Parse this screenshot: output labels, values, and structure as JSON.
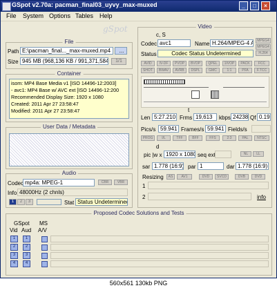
{
  "window": {
    "title": "GSpot v2.70a: pacman_final03_uyvy_max-muxed",
    "minimize": "_",
    "maximize": "□",
    "close": "×"
  },
  "menu": [
    "File",
    "System",
    "Options",
    "Tables",
    "Help"
  ],
  "file": {
    "title": "File",
    "path_label": "Path",
    "path_value": "E:\\pacman_final..._max-muxed.mp4",
    "browse": "...",
    "size_label": "Size",
    "size_value": "945 MB (968,136 KB / 991,371,584",
    "page": "1/1"
  },
  "container": {
    "title": "Container",
    "lines": [
      "isom: MP4  Base Media v1 [ISO 14496-12:2003]",
      "- avc1: MP4 Base w/ AVC ext [ISO 14496-12:200",
      "Recommended Display Size: 1920 x 1080",
      "Created:   2011 Apr 27   23:58:47",
      "Modified:  2011 Apr 27   23:58:47"
    ]
  },
  "userdata": {
    "title": "User Data / Metadata"
  },
  "audio": {
    "title": "Audio",
    "codec_label": "Codec",
    "codec_value": "mp4a: MPEG-1",
    "btn_cbr": "CBR",
    "btn_vbr": "VBR",
    "info_label": "Info",
    "info_value": "48000Hz  (2 chnls)",
    "stat_label": "Stat",
    "stat_value": "Status Undetermined",
    "stream_buttons": [
      "1",
      "2",
      "3"
    ]
  },
  "proposed": {
    "title": "Proposed Codec Solutions and Tests",
    "gspot_label": "GSpot",
    "vid_label": "Vid",
    "aud_label": "Aud",
    "ms_label": "MS",
    "av_label": "A/V",
    "rows": [
      "1",
      "2",
      "3",
      "4"
    ]
  },
  "video": {
    "title": "Video",
    "cs_label": "c, S",
    "codec_label": "Codec",
    "codec_value": "avc1",
    "name_label": "Name",
    "name_value": "H.264/MPEG-4 AVC",
    "side_btns": [
      "MPEG4",
      "MPEG4",
      "H.264"
    ],
    "status_label": "Status",
    "status_value": "Codec Status Undetermined",
    "tag_row1": [
      "AVID",
      "IV-DF",
      "PVOP",
      "BVOP",
      "QPEL",
      "1IVOP",
      "PACK",
      "FCC"
    ],
    "tag_row2": [
      "SHOT",
      "BWAV",
      "AVRB",
      "DSPL",
      "GMC",
      "1:1",
      "PFA",
      "F.TCC"
    ],
    "len_label": "Len",
    "len_value": "5:27.210",
    "frms_label": "Frms",
    "frms_value": "19,613",
    "kbps_label": "kbps",
    "kbps_value": "24238",
    "qf_label": "Qf",
    "qf_value": "0.195",
    "pics_label": "Pics/s",
    "pics_value": "59.941",
    "frames_label": "Frames/s",
    "frames_value": "59.941",
    "fields_label": "Fields/s",
    "rate_btns": [
      "PROG",
      "I/L",
      "TFF",
      "BFF",
      "FFS",
      "2:3",
      "PAL",
      "NTSC"
    ],
    "d_label": "d",
    "pic_label": "pic |w x h|",
    "pic_value": "1920 x 1080",
    "seqext_label": "seq ext",
    "seq_btns": [
      "NL",
      "LL"
    ],
    "sar_label": "sar",
    "sar_value": "1.778 (16:9)",
    "par_label": "par",
    "par_value": "1",
    "dar_label": "dar",
    "dar_value": "1.778 (16:9)",
    "resizing_label": "Resizing",
    "resize_btns": [
      "AS",
      "AV1",
      "DVD",
      "SVCD",
      "DVB",
      "DVD"
    ],
    "resize_rows": [
      "1",
      "2"
    ],
    "info_link": "info"
  },
  "watermark": "gSpot",
  "footer": "560x561  130kb  PNG"
}
